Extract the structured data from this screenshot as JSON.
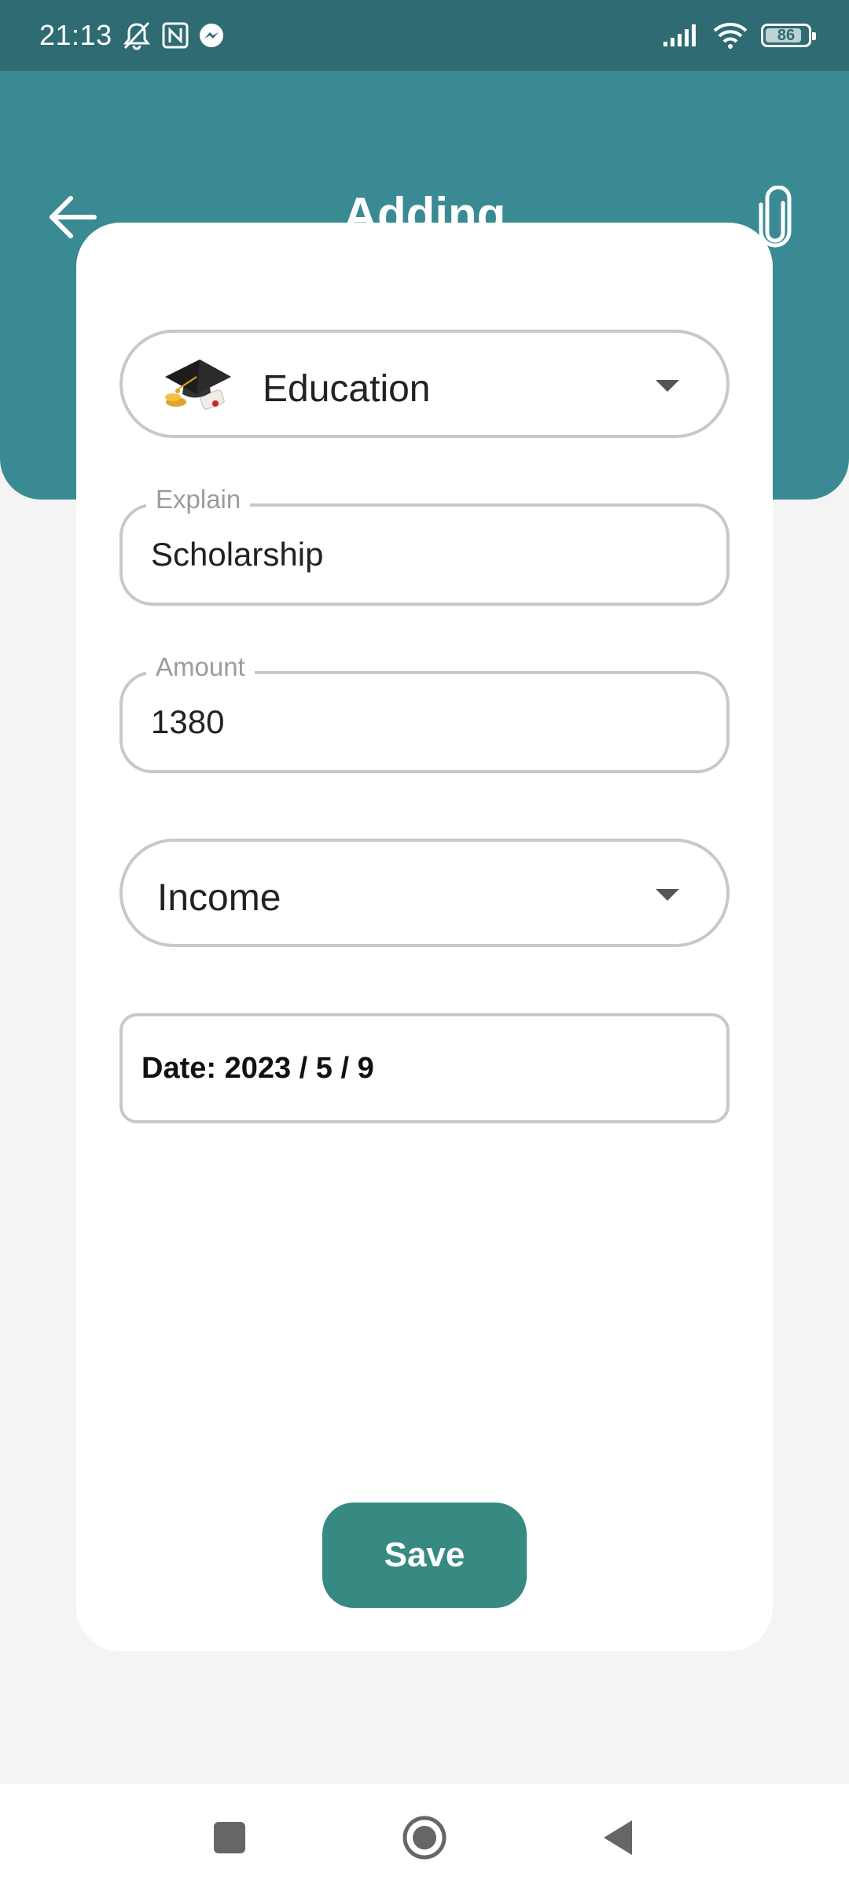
{
  "status_bar": {
    "time": "21:13",
    "battery": "86",
    "battery_level": 0.86,
    "left_icons": [
      "muted-notification-icon",
      "nfc-icon",
      "messenger-icon"
    ],
    "right_icons": [
      "signal-icon",
      "wifi-icon",
      "battery-icon"
    ]
  },
  "header": {
    "title": "Adding",
    "back_icon": "arrow-left-icon",
    "attach_icon": "paperclip-icon",
    "color": "#3a8a93"
  },
  "form": {
    "category": {
      "value": "Education",
      "icon": "graduation-cap-icon"
    },
    "explain": {
      "label": "Explain",
      "value": "Scholarship"
    },
    "amount": {
      "label": "Amount",
      "value": "1380"
    },
    "type": {
      "value": "Income"
    },
    "date": "Date: 2023 / 5 / 9"
  },
  "save_button": {
    "label": "Save",
    "color": "#378a81"
  },
  "nav_bar": {
    "icons": [
      "recents-square-icon",
      "home-circle-icon",
      "back-triangle-icon"
    ]
  }
}
